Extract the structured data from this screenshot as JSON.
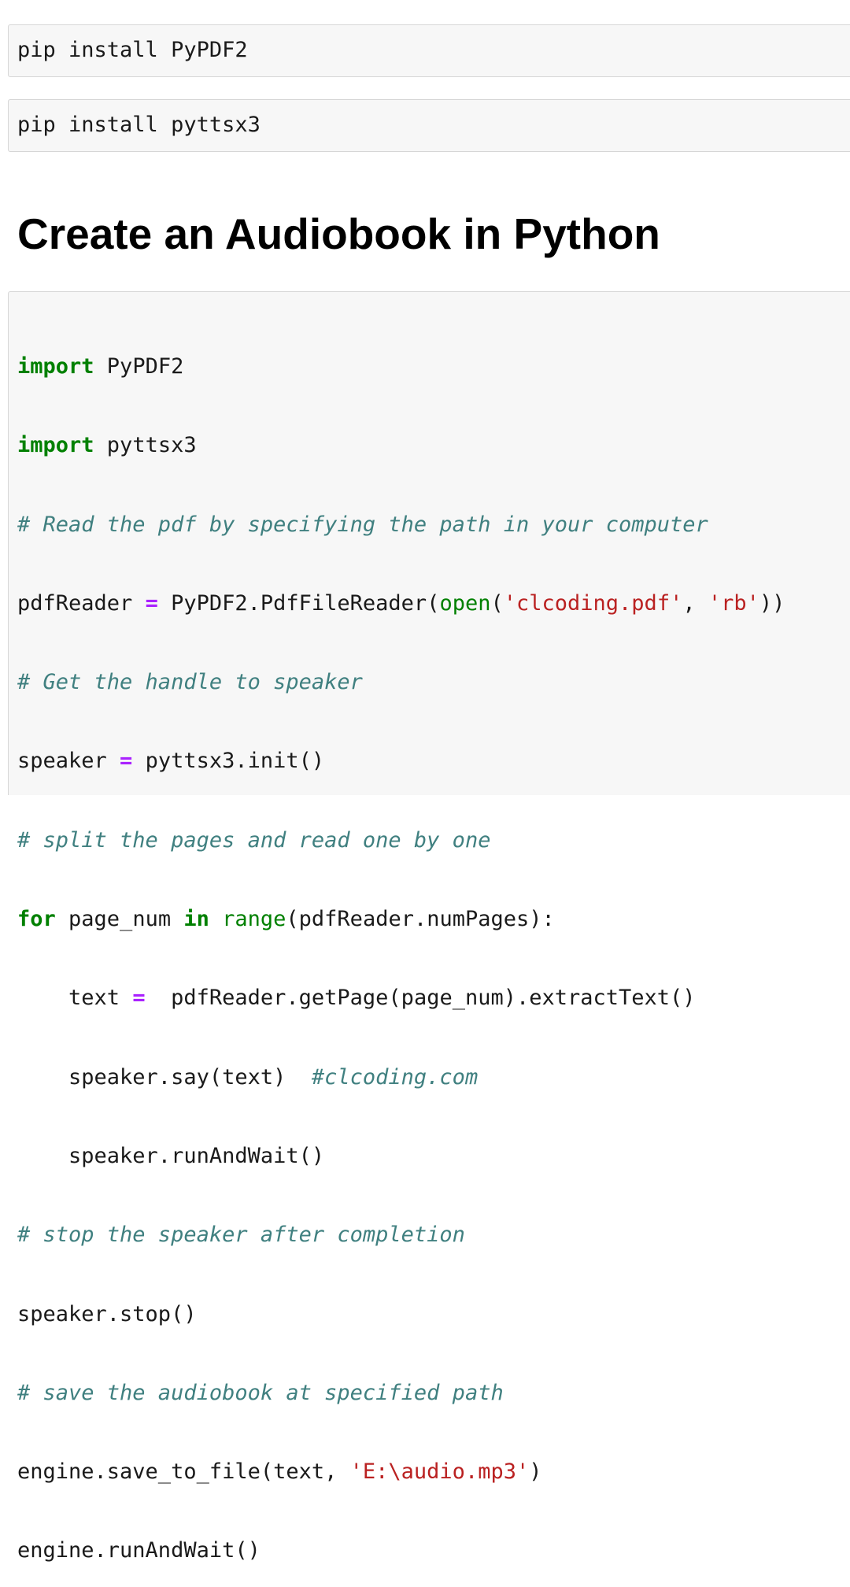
{
  "cells": {
    "install_pypdf2": "pip install PyPDF2",
    "install_pyttsx3": "pip install pyttsx3"
  },
  "heading": "Create an Audiobook in Python",
  "code": {
    "l1_kw": "import",
    "l1_rest": " PyPDF2",
    "l2_kw": "import",
    "l2_rest": " pyttsx3",
    "l3_comment": "# Read the pdf by specifying the path in your computer",
    "l4_a": "pdfReader ",
    "l4_op": "=",
    "l4_b": " PyPDF2.PdfFileReader(",
    "l4_fn": "open",
    "l4_c": "(",
    "l4_s1": "'clcoding.pdf'",
    "l4_d": ", ",
    "l4_s2": "'rb'",
    "l4_e": "))",
    "l5_comment": "# Get the handle to speaker",
    "l6_a": "speaker ",
    "l6_op": "=",
    "l6_b": " pyttsx3.init()",
    "l7_comment": "# split the pages and read one by one",
    "l8_kw": "for",
    "l8_a": " page_num ",
    "l8_in": "in",
    "l8_b": " ",
    "l8_fn": "range",
    "l8_c": "(pdfReader.numPages):",
    "l9_a": "    text ",
    "l9_op": "=",
    "l9_b": "  pdfReader.getPage(page_num).extractText()",
    "l10_a": "    speaker.say(text)  ",
    "l10_comment": "#clcoding.com",
    "l11_a": "    speaker.runAndWait()",
    "l12_comment": "# stop the speaker after completion",
    "l13_a": "speaker.stop()",
    "l14_comment": "# save the audiobook at specified path",
    "l15_a": "engine.save_to_file(text, ",
    "l15_s": "'E:\\audio.mp3'",
    "l15_b": ")",
    "l16_a": "engine.runAndWait()"
  },
  "colors": {
    "keyword": "#008000",
    "operator": "#aa22ff",
    "string": "#ba2121",
    "comment": "#408080",
    "cell_background": "#f7f7f7",
    "cell_border": "#d6d6d6"
  }
}
